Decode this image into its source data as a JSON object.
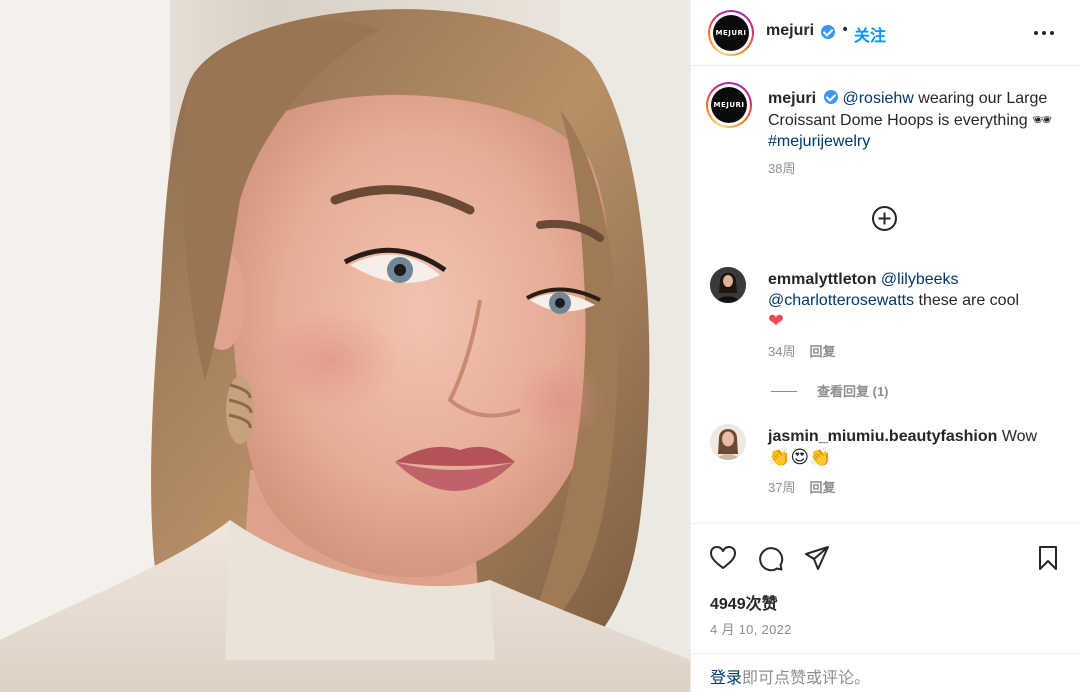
{
  "post": {
    "brand_logo_text": "MEJURI",
    "username": "mejuri",
    "dot": "•",
    "follow_label": "关注"
  },
  "caption": {
    "username": "mejuri",
    "mention": "@rosiehw",
    "text_1": " wearing our Large Croissant Dome Hoops is everything ",
    "emoji": "🕶",
    "hashtag": "#mejurijewelry",
    "time": "38周"
  },
  "comments": [
    {
      "username": "emmalyttleton",
      "mention_1": "@lilybeeks",
      "mention_2": "@charlotterosewatts",
      "text": " these are cool",
      "emoji": "❤",
      "time": "34周",
      "reply_label": "回复",
      "view_replies": "查看回复 (1)"
    },
    {
      "username": "jasmin_miumiu.beautyfashion",
      "text": " Wow",
      "emoji": "👏😍👏",
      "time": "37周",
      "reply_label": "回复"
    }
  ],
  "footer": {
    "likes": "4949次赞",
    "date": "4 月 10, 2022",
    "login_link": "登录",
    "login_text": "即可点赞或评论。"
  },
  "colors": {
    "link": "#00376b",
    "follow": "#0095f6",
    "verified": "#3897f0",
    "muted": "#8e8e8e",
    "heart": "#ed4956"
  },
  "icons": [
    "verified-badge-icon",
    "more-options-icon",
    "plus-circle-icon",
    "heart-icon",
    "comment-icon",
    "share-icon",
    "bookmark-icon"
  ]
}
